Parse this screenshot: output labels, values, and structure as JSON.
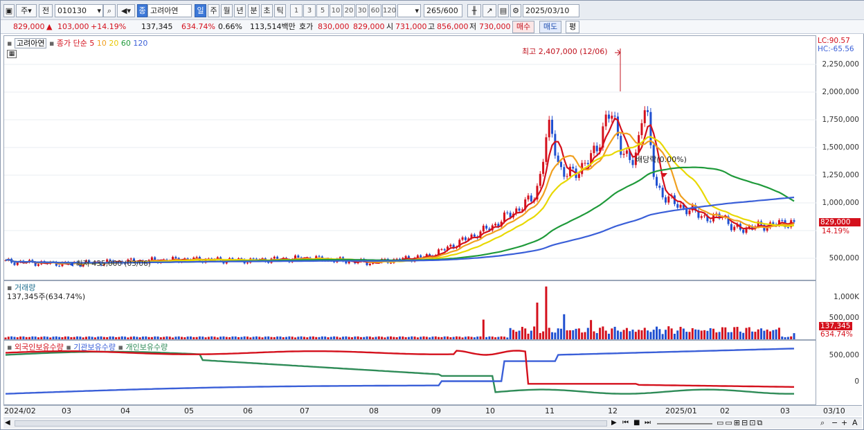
{
  "toolbar": {
    "mode_ju": "주",
    "prev": "전",
    "code": "010130",
    "name_type": "종",
    "name": "고려아연",
    "periods": [
      "일",
      "주",
      "월",
      "년",
      "분",
      "초",
      "틱"
    ],
    "selected_period": "일",
    "nums": [
      "1",
      "3",
      "5",
      "10",
      "20",
      "30",
      "60",
      "120"
    ],
    "count": "265",
    "count_max": "/600",
    "date": "2025/03/10"
  },
  "quote": {
    "price": "829,000",
    "change_arrow": "▲",
    "change": "103,000",
    "change_pct": "+14.19%",
    "volume": "137,345",
    "volume_pct": "634.74%",
    "turnover_pct": "0.66%",
    "amount": "113,514백만",
    "hoga_label": "호가",
    "ask": "830,000",
    "bid": "829,000",
    "open_label": "시",
    "open": "731,000",
    "high_label": "고",
    "high": "856,000",
    "low_label": "저",
    "low": "730,000",
    "buy": "매수",
    "sell": "매도",
    "eval": "평"
  },
  "price_pane": {
    "legend_name": "고려아연",
    "legend_ma_label": "종가 단순",
    "ma_periods": [
      "5",
      "10",
      "20",
      "60",
      "120"
    ],
    "ma_colors": [
      "#d4101c",
      "#f0a020",
      "#e8d800",
      "#1f9a3a",
      "#3a5fd8"
    ],
    "lc": "LC:90.57",
    "hc": "HC:-65.56",
    "high_annot": "최고 2,407,000 (12/06)",
    "low_annot": "최저 435,000 (03/06)",
    "div_annot": "배당락(0.00%)",
    "last_tag": "829,000",
    "last_pct": "14.19%",
    "y_ticks": [
      "2,250,000",
      "2,000,000",
      "1,750,000",
      "1,500,000",
      "1,250,000",
      "1,000,000",
      "750,000",
      "500,000"
    ]
  },
  "volume_pane": {
    "title": "거래량",
    "value": "137,345주(634.74%)",
    "y_ticks": [
      "1,000K",
      "500,000"
    ],
    "last_tag": "137,345",
    "last_pct": "634.74%"
  },
  "holder_pane": {
    "legend": [
      "외국인보유수량",
      "기관보유수량",
      "개인보유수량"
    ],
    "colors": [
      "#d4101c",
      "#3a5fd8",
      "#2e8b57"
    ],
    "y_ticks": [
      "500,000",
      "0"
    ]
  },
  "x_axis": [
    "2024/02",
    "03",
    "04",
    "05",
    "06",
    "07",
    "08",
    "09",
    "10",
    "11",
    "12",
    "2025/01",
    "02",
    "03",
    "03/10"
  ],
  "chart_data": {
    "type": "line",
    "title": "",
    "x": [
      "2024-02",
      "2024-03",
      "2024-04",
      "2024-05",
      "2024-06",
      "2024-07",
      "2024-08",
      "2024-09",
      "2024-10",
      "2024-11",
      "2024-12",
      "2025-01",
      "2025-02",
      "2025-03"
    ],
    "series": [
      {
        "name": "종가",
        "values": [
          470000,
          450000,
          470000,
          490000,
          480000,
          500000,
          460000,
          520000,
          780000,
          1150000,
          1500000,
          1000000,
          760000,
          829000
        ]
      }
    ],
    "high": 2407000,
    "low": 435000,
    "ylim": [
      380000,
      2400000
    ],
    "ylabel": ""
  }
}
